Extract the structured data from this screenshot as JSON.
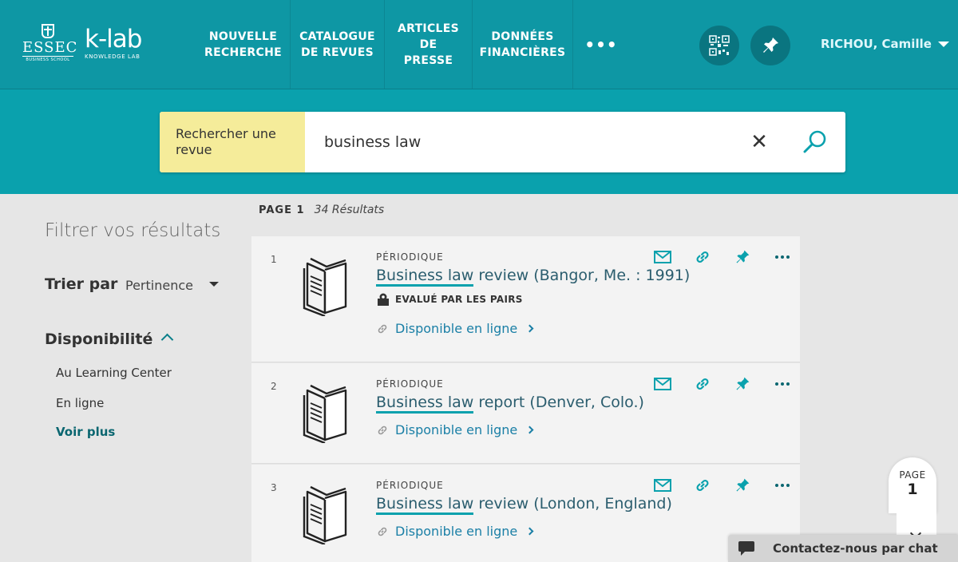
{
  "header": {
    "logo_essec": {
      "name": "ESSEC",
      "sub": "BUSINESS SCHOOL"
    },
    "logo_klab": {
      "name": "k-lab",
      "sub": "KNOWLEDGE LAB"
    },
    "nav": [
      {
        "line1": "NOUVELLE",
        "line2": "RECHERCHE"
      },
      {
        "line1": "CATALOGUE",
        "line2": "DE REVUES"
      },
      {
        "line1": "ARTICLES",
        "line2": "DE PRESSE"
      },
      {
        "line1": "DONNÉES",
        "line2": "FINANCIÈRES"
      }
    ],
    "nav_more": "•••",
    "user_name": "RICHOU, Camille"
  },
  "search": {
    "scope": "Rechercher une revue",
    "query": "business law",
    "clear": "✕"
  },
  "sidebar": {
    "filter_title": "Filtrer vos résultats",
    "sort_label": "Trier par",
    "sort_value": "Pertinence",
    "availability_title": "Disponibilité",
    "facets": [
      "Au Learning Center",
      "En ligne"
    ],
    "more": "Voir plus"
  },
  "results_meta": {
    "page": "PAGE 1",
    "count": "34 Résultats"
  },
  "results": [
    {
      "num": "1",
      "type": "PÉRIODIQUE",
      "title_highlight": "Business law",
      "title_rest": " review (Bangor, Me. : 1991)",
      "peer": "EVALUÉ PAR LES PAIRS",
      "availability": "Disponible en ligne"
    },
    {
      "num": "2",
      "type": "PÉRIODIQUE",
      "title_highlight": "Business law",
      "title_rest": " report (Denver, Colo.)",
      "peer": "",
      "availability": "Disponible en ligne"
    },
    {
      "num": "3",
      "type": "PÉRIODIQUE",
      "title_highlight": "Business law",
      "title_rest": " review (London, England)",
      "peer": "",
      "availability": "Disponible en ligne"
    }
  ],
  "page_indicator": {
    "label": "PAGE",
    "value": "1"
  },
  "chat": {
    "label": "Contactez-nous par chat"
  },
  "colors": {
    "header": "#0e97a4",
    "search_band": "#0aa1ad",
    "scope_bg": "#f5ec9a",
    "accent": "#0aa1ad"
  }
}
